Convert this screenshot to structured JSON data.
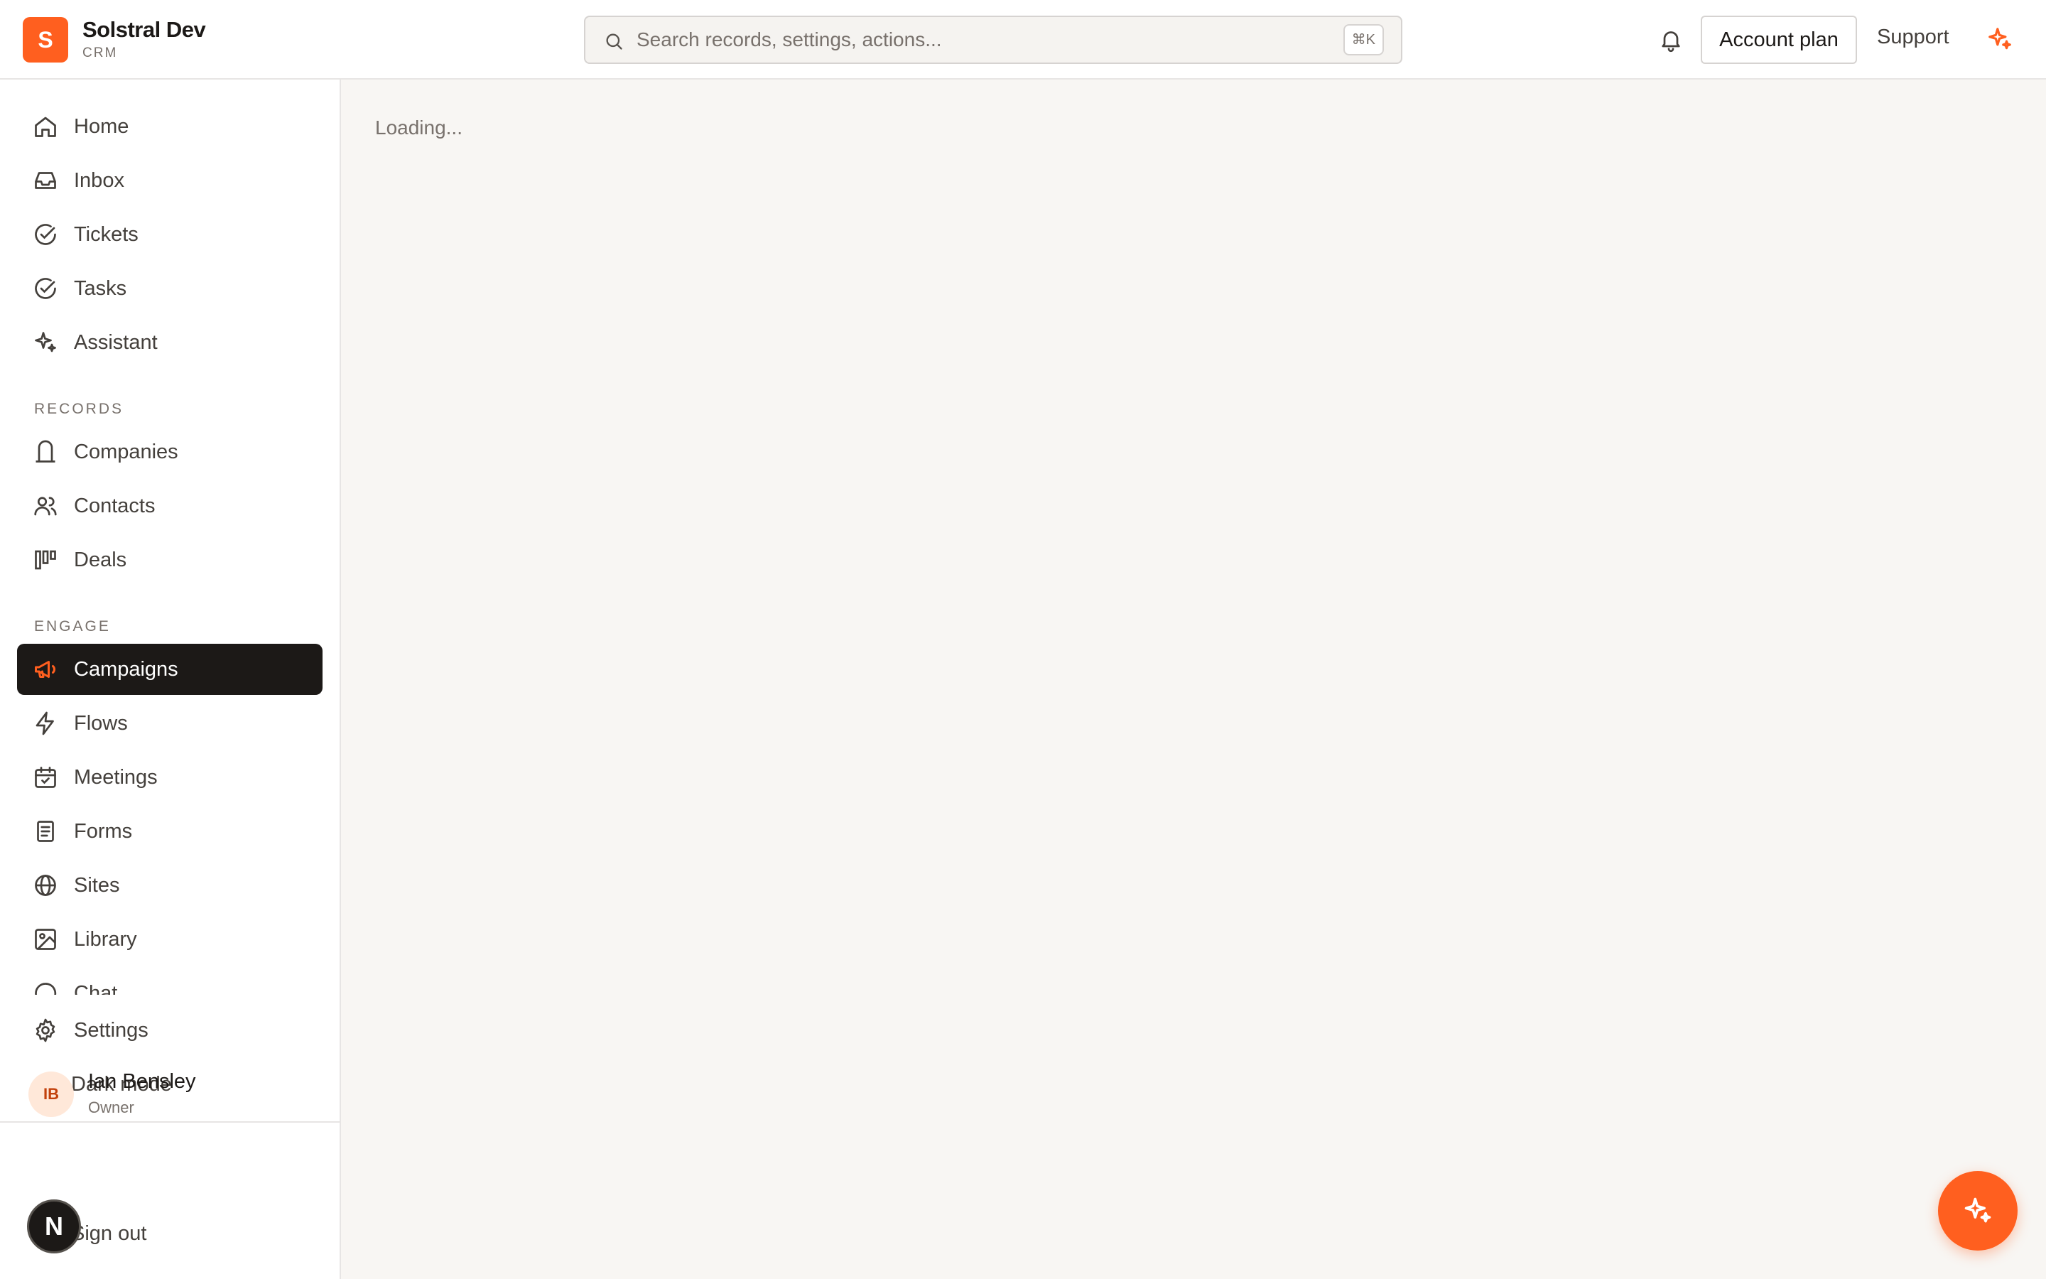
{
  "app": {
    "logo_letter": "S",
    "name": "Solstral Dev",
    "subtitle": "CRM"
  },
  "header": {
    "search_placeholder": "Search records, settings, actions...",
    "search_shortcut": "⌘K",
    "account_plan": "Account plan",
    "support": "Support"
  },
  "sidebar": {
    "main_items": [
      {
        "label": "Home",
        "icon": "home-icon"
      },
      {
        "label": "Inbox",
        "icon": "inbox-icon"
      },
      {
        "label": "Tickets",
        "icon": "check-circle-icon"
      },
      {
        "label": "Tasks",
        "icon": "check-circle-icon"
      },
      {
        "label": "Assistant",
        "icon": "sparkle-icon"
      }
    ],
    "records_label": "RECORDS",
    "records_items": [
      {
        "label": "Companies",
        "icon": "building-icon"
      },
      {
        "label": "Contacts",
        "icon": "users-icon"
      },
      {
        "label": "Deals",
        "icon": "kanban-icon"
      }
    ],
    "engage_label": "ENGAGE",
    "engage_items": [
      {
        "label": "Campaigns",
        "icon": "megaphone-icon",
        "active": true
      },
      {
        "label": "Flows",
        "icon": "bolt-icon"
      },
      {
        "label": "Meetings",
        "icon": "calendar-icon"
      },
      {
        "label": "Forms",
        "icon": "form-icon"
      },
      {
        "label": "Sites",
        "icon": "globe-icon"
      },
      {
        "label": "Library",
        "icon": "image-icon"
      },
      {
        "label": "Chat",
        "icon": "chat-icon"
      }
    ],
    "settings": "Settings",
    "dark_mode": "Dark mode"
  },
  "user": {
    "initials": "IB",
    "name": "Ian Bensley",
    "role": "Owner",
    "sign_out": "Sign out"
  },
  "dev_badge": "N",
  "main": {
    "loading_text": "Loading..."
  },
  "colors": {
    "accent": "#ff5f1f",
    "active_bg": "#1c1917",
    "main_bg": "#f8f6f3",
    "border": "#e7e5e4"
  }
}
